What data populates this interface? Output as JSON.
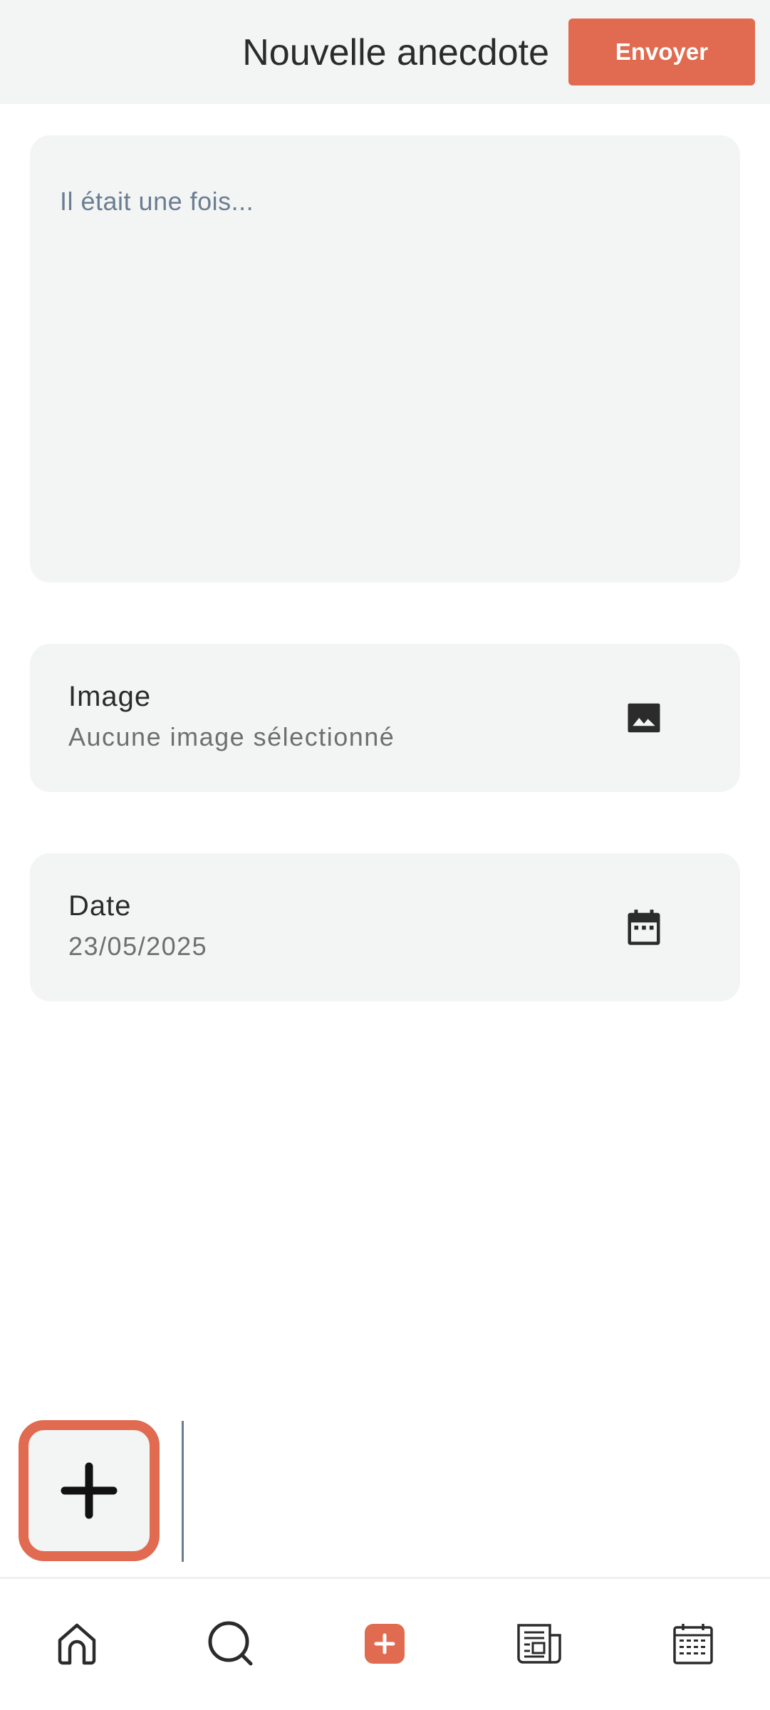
{
  "header": {
    "title": "Nouvelle anecdote",
    "send_label": "Envoyer"
  },
  "story": {
    "placeholder": "Il était une fois..."
  },
  "image_field": {
    "label": "Image",
    "value": "Aucune image sélectionné",
    "icon": "image-icon"
  },
  "date_field": {
    "label": "Date",
    "value": "23/05/2025",
    "icon": "calendar-icon"
  },
  "fab": {
    "icon": "plus-icon"
  },
  "bottom_nav": {
    "items": [
      {
        "name": "home",
        "icon": "home-icon"
      },
      {
        "name": "search",
        "icon": "search-icon"
      },
      {
        "name": "add",
        "icon": "add-square-icon",
        "active": true
      },
      {
        "name": "news",
        "icon": "newspaper-icon"
      },
      {
        "name": "calendar",
        "icon": "calendar-grid-icon"
      }
    ]
  },
  "colors": {
    "accent": "#e06b50",
    "card_bg": "#f3f4f4",
    "placeholder": "#6b7d92"
  }
}
